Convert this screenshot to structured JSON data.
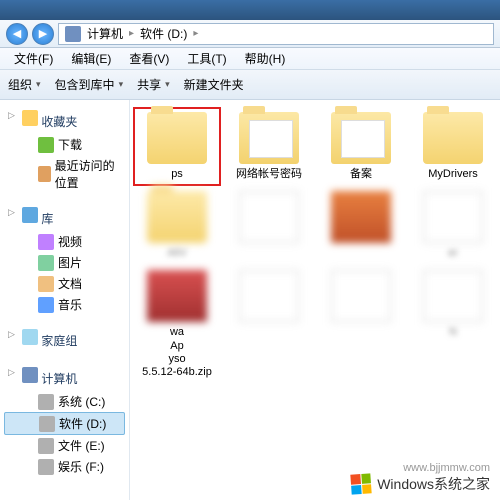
{
  "titlebar": {
    "title": ""
  },
  "address": {
    "back": "◀",
    "fwd": "▶",
    "crumbs": [
      "计算机",
      "软件 (D:)"
    ]
  },
  "menu": {
    "file": "文件(F)",
    "edit": "编辑(E)",
    "view": "查看(V)",
    "tools": "工具(T)",
    "help": "帮助(H)"
  },
  "toolbar": {
    "organize": "组织",
    "include": "包含到库中",
    "share": "共享",
    "newfolder": "新建文件夹"
  },
  "sidebar": {
    "fav": {
      "label": "收藏夹",
      "items": [
        "下载",
        "最近访问的位置"
      ]
    },
    "lib": {
      "label": "库",
      "items": [
        "视频",
        "图片",
        "文档",
        "音乐"
      ]
    },
    "home": {
      "label": "家庭组"
    },
    "comp": {
      "label": "计算机",
      "items": [
        "系统 (C:)",
        "软件 (D:)",
        "文件 (E:)",
        "娱乐 (F:)"
      ]
    }
  },
  "files": {
    "row1": [
      {
        "name": "ps",
        "type": "folder",
        "hl": true
      },
      {
        "name": "网络帐号密码",
        "type": "folder-open"
      },
      {
        "name": "备案",
        "type": "folder-open"
      },
      {
        "name": "MyDrivers",
        "type": "folder"
      }
    ],
    "row2": [
      {
        "name": "AliV",
        "type": "folder",
        "blur": true
      },
      {
        "name": "",
        "type": "file",
        "blur": true
      },
      {
        "name": "",
        "type": "img1",
        "blur": true
      },
      {
        "name": "er",
        "type": "file",
        "blur": true
      }
    ],
    "row3": [
      {
        "name": "wa\nAp\nyso\n5.5.12-64b.zip",
        "type": "img2",
        "blur": true
      },
      {
        "name": "",
        "type": "file",
        "blur": true
      },
      {
        "name": "",
        "type": "file",
        "blur": true
      },
      {
        "name": "N",
        "type": "file",
        "blur": true
      }
    ]
  },
  "watermark": {
    "text": "Windows系统之家",
    "url": "www.bjjmmw.com"
  }
}
